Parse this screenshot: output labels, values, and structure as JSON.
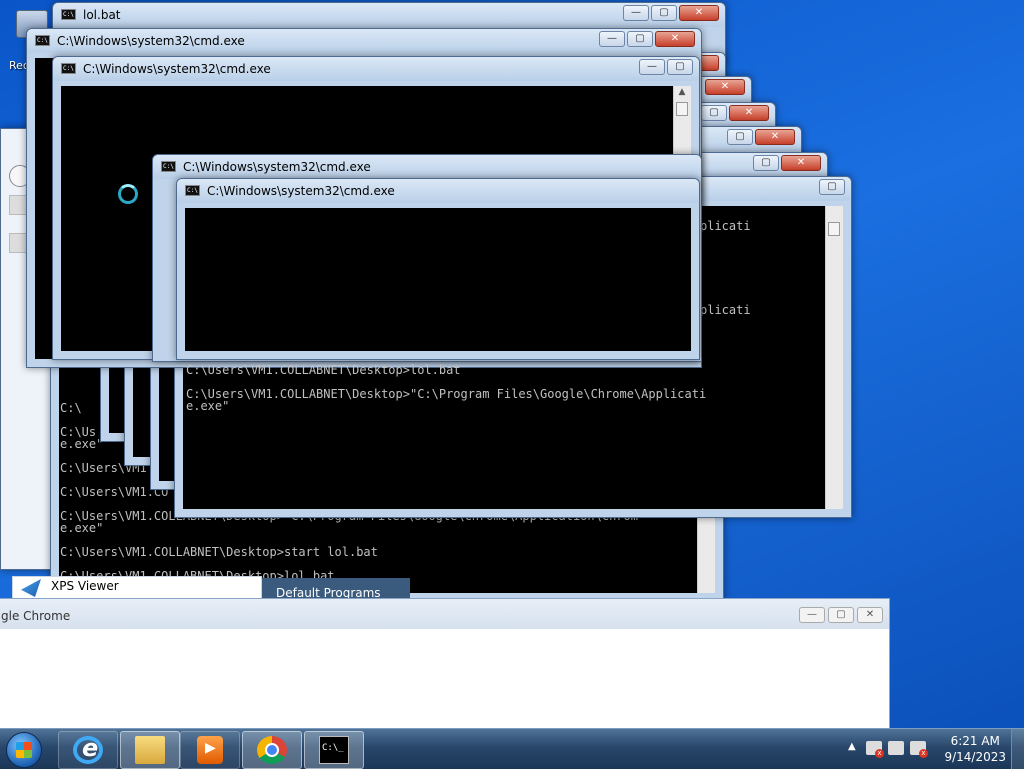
{
  "desktop": {
    "recycle_label": "Rec"
  },
  "windows": {
    "w_lol": {
      "title": "lol.bat"
    },
    "w_cmd_main": {
      "title": "C:\\Windows\\system32\\cmd.exe"
    },
    "w_cmd_inner": {
      "title": "C:\\Windows\\system32\\cmd.exe"
    },
    "w_cmd_mid": {
      "title": "C:\\Windows\\system32\\cmd.exe"
    },
    "w_cmd_front": {
      "title": "C:\\Windows\\system32\\cmd.exe"
    }
  },
  "window_buttons": {
    "minimize": "—",
    "maximize": "▢",
    "close": "✕"
  },
  "console": {
    "back_lines": [
      "C:\\",
      "",
      "C:\\Us",
      "e.exe\"",
      "",
      "C:\\Users\\VM1",
      "",
      "C:\\Users\\VM1.CO",
      "",
      "C:\\Users\\VM1.COLLABNET\\Desktop>\"C:\\Program Files\\Google\\Chrome\\Application\\Chrom",
      "e.exe\"",
      "",
      "C:\\Users\\VM1.COLLABNET\\Desktop>start lol.bat",
      "",
      "C:\\Users\\VM1.COLLABNET\\Desktop>lol.bat"
    ],
    "right_lines": [
      "C:\\Users\\VM1.COLLABNET\\Desktop>lol.bat",
      "",
      "C:\\Users\\VM1.COLLABNET\\Desktop>\"C:\\Program Files\\Google\\Chrome\\Applicati",
      "e.exe\""
    ],
    "right_frag_1": "plicati",
    "right_frag_2": "plicati"
  },
  "chrome_window": {
    "title": "gle Chrome"
  },
  "xps_viewer": {
    "label": "XPS Viewer"
  },
  "default_programs": {
    "label": "Default Programs"
  },
  "taskbar": {
    "clock_time": "6:21 AM",
    "clock_date": "9/14/2023",
    "tray_arrow": "▲",
    "items": [
      {
        "name": "internet-explorer-icon"
      },
      {
        "name": "file-explorer-icon"
      },
      {
        "name": "media-player-icon"
      },
      {
        "name": "chrome-icon"
      },
      {
        "name": "cmd-icon"
      }
    ]
  },
  "colors": {
    "desktop_blue": "#1b6fe0",
    "console_text": "#c0c0c0",
    "title_bar": "#bfd3ea",
    "close_red": "#c7402b"
  }
}
